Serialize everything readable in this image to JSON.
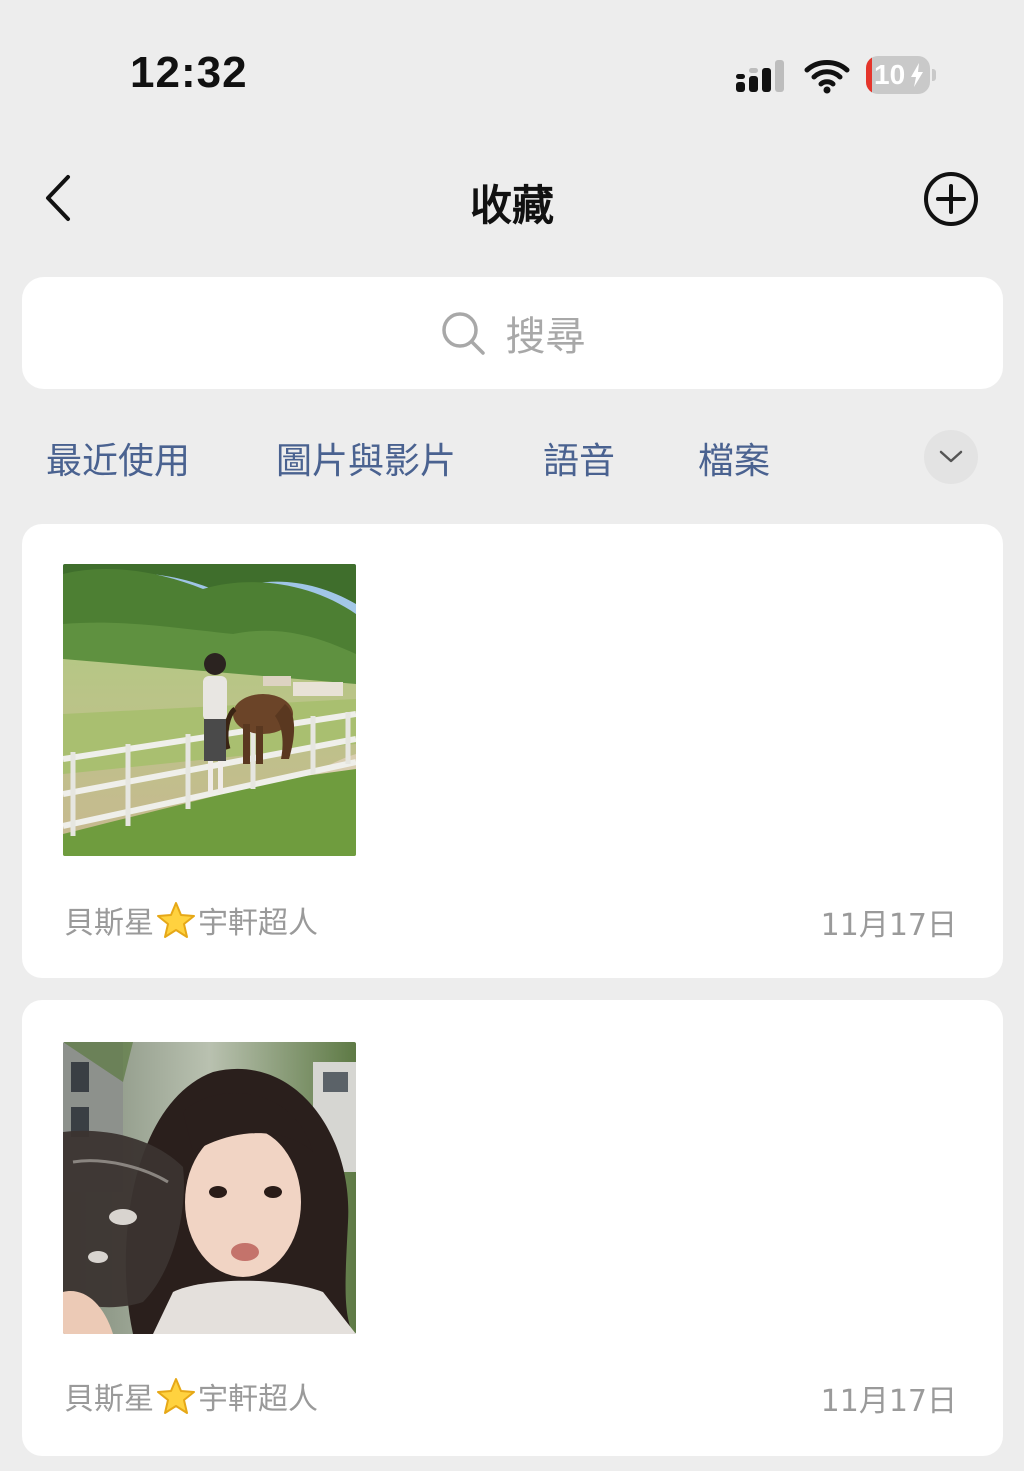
{
  "status_bar": {
    "time": "12:32",
    "battery_text": "10",
    "battery_level_percent": 10,
    "icons": [
      "signal-icon",
      "wifi-icon",
      "battery-icon",
      "charging-bolt-icon"
    ]
  },
  "nav": {
    "title": "收藏",
    "icons": [
      "back-chevron-icon",
      "add-circle-icon"
    ]
  },
  "search": {
    "placeholder": "搜尋",
    "icon": "search-icon"
  },
  "tabs": [
    {
      "label": "最近使用"
    },
    {
      "label": "圖片與影片"
    },
    {
      "label": "語音"
    },
    {
      "label": "檔案"
    }
  ],
  "tabs_expand_icon": "chevron-down-icon",
  "items": [
    {
      "source_prefix": "貝斯星",
      "source_suffix": "宇軒超人",
      "source_emoji": "star-icon",
      "date": "11月17日"
    },
    {
      "source_prefix": "貝斯星",
      "source_suffix": "宇軒超人",
      "source_emoji": "star-icon",
      "date": "11月17日"
    }
  ],
  "colors": {
    "background": "#ededed",
    "card": "#ffffff",
    "tab_text": "#4a6290",
    "meta_text": "#9a9a9a",
    "placeholder": "#a8a8a8",
    "battery_low": "#e5352b"
  }
}
